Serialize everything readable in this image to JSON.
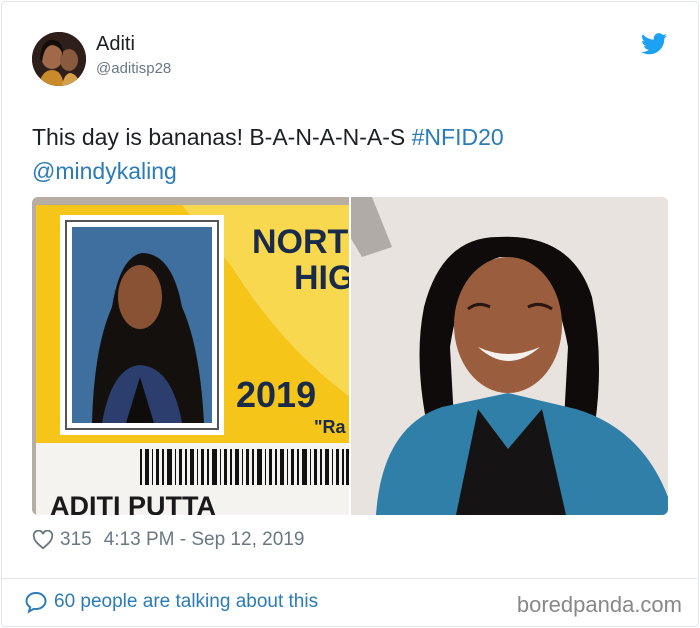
{
  "user": {
    "name": "Aditi",
    "handle": "@aditisp28"
  },
  "tweet": {
    "text": "This day is bananas! B-A-N-A-N-A-S ",
    "hashtag": "#NFID20",
    "mention": "@mindykaling",
    "likes": "315",
    "timestamp": "4:13 PM - Sep 12, 2019"
  },
  "id_card": {
    "school_line1": "NORTH",
    "school_line2": "HIG",
    "year": "2019",
    "quote": "\"Ra",
    "student_name": "ADITI PUTTA"
  },
  "footer": {
    "talking": "60 people are talking about this",
    "watermark": "boredpanda.com"
  },
  "colors": {
    "link": "#2b7bb9",
    "twitter_blue": "#1da1f2",
    "muted": "#697882",
    "card_yellow": "#f5c51a"
  },
  "icons": [
    "twitter-bird-icon",
    "heart-icon",
    "speech-bubble-icon"
  ]
}
